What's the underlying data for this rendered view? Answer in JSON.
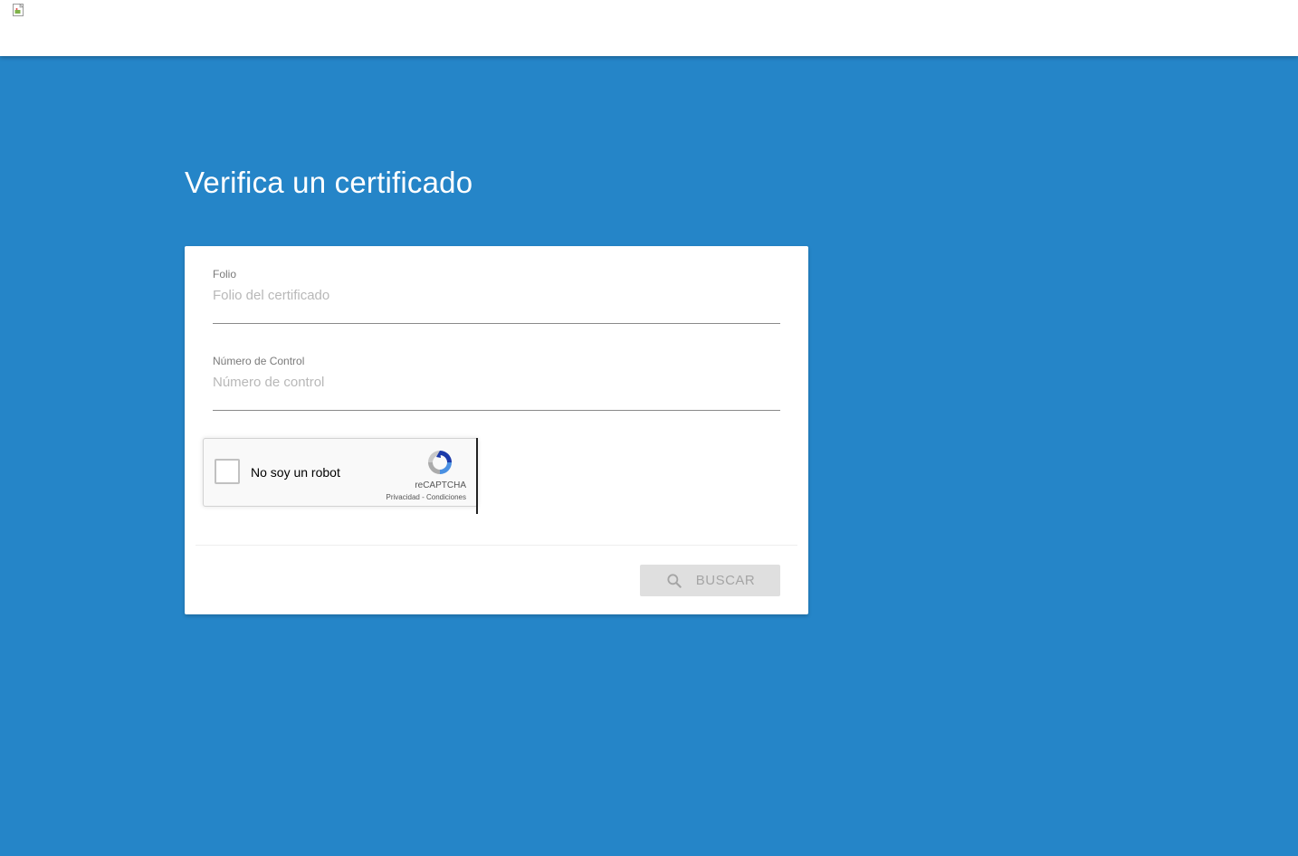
{
  "page": {
    "title": "Verifica un certificado"
  },
  "form": {
    "folio": {
      "label": "Folio",
      "placeholder": "Folio del certificado",
      "value": ""
    },
    "control": {
      "label": "Número de Control",
      "placeholder": "Número de control",
      "value": ""
    },
    "recaptcha": {
      "label": "No soy un robot",
      "brand": "reCAPTCHA",
      "privacy": "Privacidad",
      "separator": " - ",
      "terms": "Condiciones",
      "checked": false
    },
    "submit": {
      "label": "BUSCAR",
      "icon": "search-icon",
      "disabled": true
    }
  },
  "colors": {
    "background": "#2585c8",
    "card": "#ffffff",
    "button_disabled_bg": "#dfdfdf",
    "button_disabled_text": "#a5a5a5"
  }
}
